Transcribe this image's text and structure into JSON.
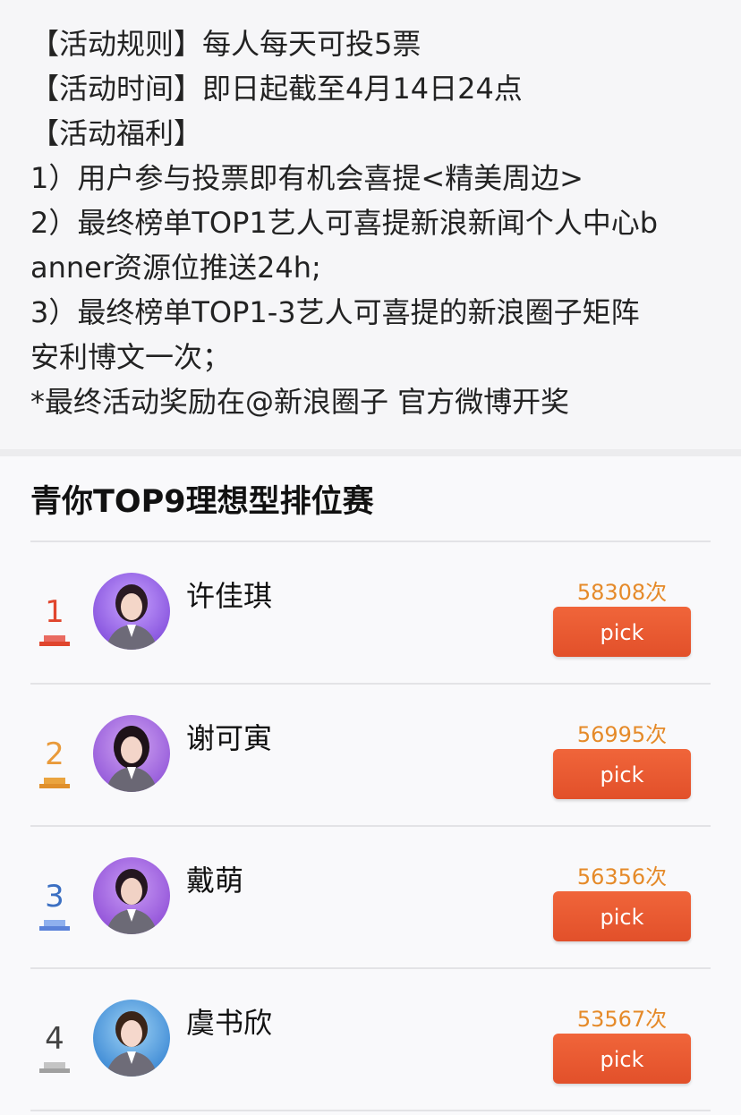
{
  "rules": {
    "lines": [
      "【活动规则】每人每天可投5票",
      "【活动时间】即日起截至4月14日24点",
      "【活动福利】",
      "1）用户参与投票即有机会喜提<精美周边>",
      "2）最终榜单TOP1艺人可喜提新浪新闻个人中心b",
      "anner资源位推送24h;",
      "3）最终榜单TOP1-3艺人可喜提的新浪圈子矩阵",
      "安利博文一次；",
      "*最终活动奖励在@新浪圈子 官方微博开奖"
    ]
  },
  "section": {
    "title": "青你TOP9理想型排位赛"
  },
  "ranking": [
    {
      "rank": "1",
      "name": "许佳琪",
      "votes": "58308次",
      "button": "pick",
      "rank_color": "#e0452d",
      "podium_color": "#e96b61"
    },
    {
      "rank": "2",
      "name": "谢可寅",
      "votes": "56995次",
      "button": "pick",
      "rank_color": "#e99a3a",
      "podium_color": "#eaa43f"
    },
    {
      "rank": "3",
      "name": "戴萌",
      "votes": "56356次",
      "button": "pick",
      "rank_color": "#3b6fc2",
      "podium_color": "#6f93e6"
    },
    {
      "rank": "4",
      "name": "虞书欣",
      "votes": "53567次",
      "button": "pick",
      "rank_color": "#444444",
      "podium_color": "#a9a9a9"
    }
  ],
  "colors": {
    "accent": "#e9572d",
    "votes": "#e58a29"
  }
}
